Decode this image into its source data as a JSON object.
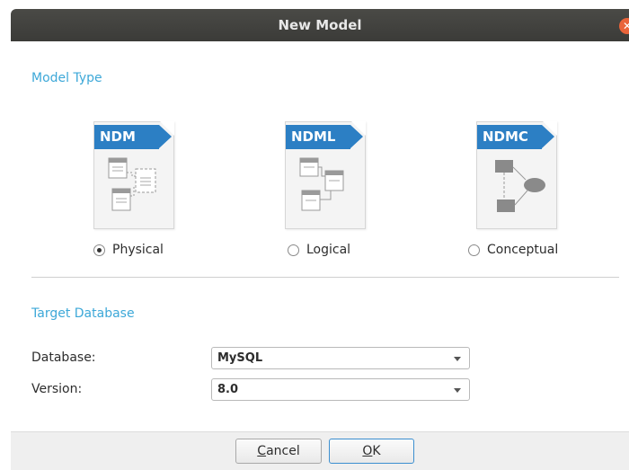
{
  "window": {
    "title": "New Model"
  },
  "model_type": {
    "title": "Model Type",
    "options": [
      {
        "badge": "NDM",
        "label": "Physical",
        "selected": true
      },
      {
        "badge": "NDML",
        "label": "Logical",
        "selected": false
      },
      {
        "badge": "NDMC",
        "label": "Conceptual",
        "selected": false
      }
    ]
  },
  "target_database": {
    "title": "Target Database",
    "database_label": "Database:",
    "database_value": "MySQL",
    "version_label": "Version:",
    "version_value": "8.0"
  },
  "buttons": {
    "cancel_mnemonic": "C",
    "cancel_rest": "ancel",
    "ok_mnemonic": "O",
    "ok_rest": "K"
  },
  "colors": {
    "accent": "#3da8d8",
    "badge": "#2c7fc4",
    "close": "#e9643a"
  }
}
